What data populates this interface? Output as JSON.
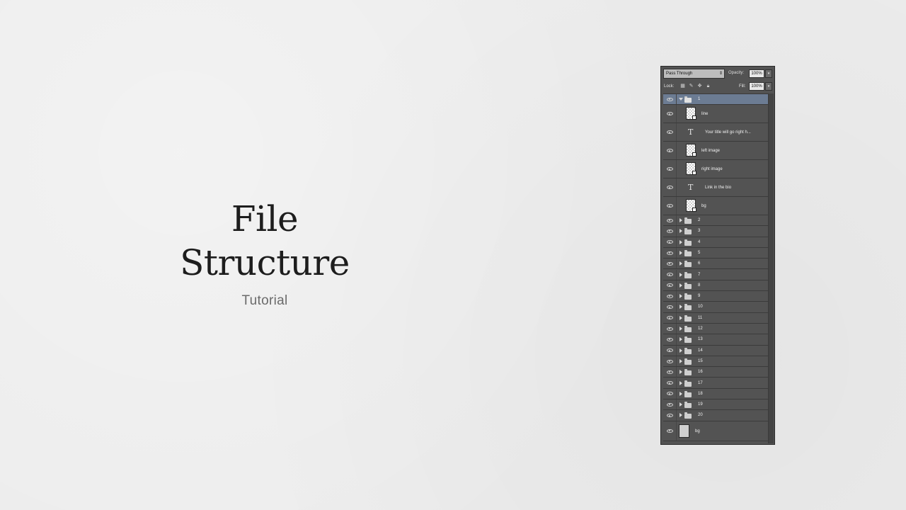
{
  "slide": {
    "title_line1": "File",
    "title_line2": "Structure",
    "subtitle": "Tutorial"
  },
  "layers_panel": {
    "blend_mode": "Pass Through",
    "opacity_label": "Opacity:",
    "opacity_value": "100%",
    "lock_label": "Lock:",
    "fill_label": "Fill:",
    "fill_value": "100%",
    "expanded_group": {
      "name": "1",
      "children": [
        {
          "name": "line",
          "kind": "smart-object"
        },
        {
          "name": "Your title will go  right h...",
          "kind": "text"
        },
        {
          "name": "left image",
          "kind": "smart-object"
        },
        {
          "name": "right image",
          "kind": "smart-object"
        },
        {
          "name": "Link in the bio",
          "kind": "text"
        },
        {
          "name": "bg",
          "kind": "smart-object"
        }
      ]
    },
    "collapsed_groups": [
      "2",
      "3",
      "4",
      "5",
      "6",
      "7",
      "8",
      "9",
      "10",
      "11",
      "12",
      "13",
      "14",
      "15",
      "16",
      "17",
      "18",
      "19",
      "20"
    ],
    "background_layer": {
      "name": "bg"
    },
    "colors": {
      "panel_bg": "#535353",
      "selected_row": "#6c7c93"
    }
  }
}
